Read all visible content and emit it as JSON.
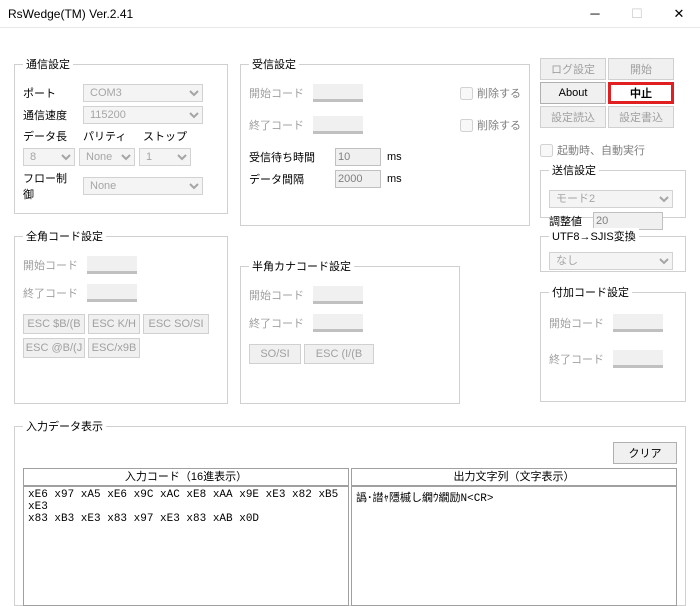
{
  "window": {
    "title": "RsWedge(TM) Ver.2.41"
  },
  "comm": {
    "legend": "通信設定",
    "port_lbl": "ポート",
    "port_val": "COM3",
    "baud_lbl": "通信速度",
    "baud_val": "115200",
    "data_lbl": "データ長",
    "parity_lbl": "パリティ",
    "stop_lbl": "ストップ",
    "data_val": "8",
    "parity_val": "None",
    "stop_val": "1",
    "flow_lbl": "フロー制御",
    "flow_val": "None"
  },
  "recv": {
    "legend": "受信設定",
    "start_code": "開始コード",
    "end_code": "終了コード",
    "delete": "削除する",
    "wait_lbl": "受信待ち時間",
    "wait_val": "10",
    "interval_lbl": "データ間隔",
    "interval_val": "2000",
    "ms": "ms"
  },
  "zen": {
    "legend": "全角コード設定",
    "start_code": "開始コード",
    "end_code": "終了コード",
    "btn1": "ESC $B/(B",
    "btn2": "ESC K/H",
    "btn3": "ESC SO/SI",
    "btn4": "ESC @B/(J",
    "btn5": "ESC/x9B"
  },
  "han": {
    "legend": "半角カナコード設定",
    "start_code": "開始コード",
    "end_code": "終了コード",
    "btn1": "SO/SI",
    "btn2": "ESC (I/(B"
  },
  "right_buttons": {
    "log": "ログ設定",
    "start": "開始",
    "about": "About",
    "stop": "中止",
    "load": "設定読込",
    "save": "設定書込"
  },
  "autorun": "起動時、自動実行",
  "send": {
    "legend": "送信設定",
    "mode_lbl": "モード",
    "mode_val": "モード2",
    "adj_lbl": "調整値",
    "adj_val": "20"
  },
  "utf": {
    "legend": "UTF8→SJIS変換",
    "val": "なし"
  },
  "addcode": {
    "legend": "付加コード設定",
    "start_code": "開始コード",
    "end_code": "終了コード"
  },
  "display": {
    "legend": "入力データ表示",
    "clear": "クリア",
    "hdr_in": "入力コード（16進表示）",
    "hdr_out": "出力文字列（文字表示）",
    "in_text": "xE6 x97 xA5 xE6 x9C xAC xE8 xAA x9E xE3 x82 xB5 xE3\nx83 xB3 xE3 x83 x97 xE3 x83 xAB x0D",
    "out_text": "譌･譛ｬ隱槭し繝ｳ繝励Ν<CR>"
  }
}
